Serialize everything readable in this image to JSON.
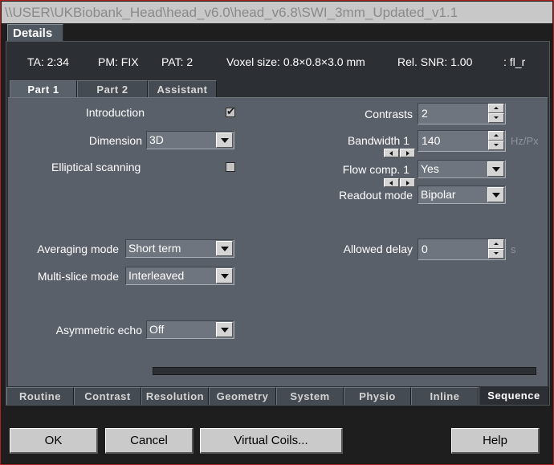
{
  "window": {
    "title": "\\\\USER\\UKBiobank_Head\\head_v6.0\\head_v6.8\\SWI_3mm_Updated_v1.1"
  },
  "details_tab": "Details",
  "info": {
    "ta": "TA: 2:34",
    "pm": "PM: FIX",
    "pat": "PAT: 2",
    "voxel": "Voxel size: 0.8×0.8×3.0 mm",
    "snr": "Rel. SNR: 1.00",
    "seq": ": fl_r"
  },
  "part_tabs": [
    {
      "label": "Part 1",
      "active": true
    },
    {
      "label": "Part 2",
      "active": false
    },
    {
      "label": "Assistant",
      "active": false
    }
  ],
  "left": {
    "introduction": {
      "label": "Introduction",
      "checked": true,
      "mark": "✔"
    },
    "dimension": {
      "label": "Dimension",
      "value": "3D"
    },
    "elliptical": {
      "label": "Elliptical scanning",
      "checked": false
    },
    "averaging": {
      "label": "Averaging mode",
      "value": "Short term"
    },
    "multislice": {
      "label": "Multi-slice mode",
      "value": "Interleaved"
    },
    "asymmetric": {
      "label": "Asymmetric echo",
      "value": "Off"
    }
  },
  "right": {
    "contrasts": {
      "label": "Contrasts",
      "value": "2"
    },
    "bandwidth": {
      "label": "Bandwidth 1",
      "value": "140",
      "unit": "Hz/Px"
    },
    "flowcomp": {
      "label": "Flow comp. 1",
      "value": "Yes"
    },
    "readout": {
      "label": "Readout mode",
      "value": "Bipolar"
    },
    "delay": {
      "label": "Allowed delay",
      "value": "0",
      "unit": "s"
    }
  },
  "bottom_tabs": [
    {
      "label": "Routine",
      "active": false
    },
    {
      "label": "Contrast",
      "active": false
    },
    {
      "label": "Resolution",
      "active": false
    },
    {
      "label": "Geometry",
      "active": false
    },
    {
      "label": "System",
      "active": false
    },
    {
      "label": "Physio",
      "active": false
    },
    {
      "label": "Inline",
      "active": false
    },
    {
      "label": "Sequence",
      "active": true
    }
  ],
  "buttons": {
    "ok": "OK",
    "cancel": "Cancel",
    "virtual_coils": "Virtual Coils...",
    "help": "Help"
  },
  "colors": {
    "accent_border": "#b02020",
    "panel": "#596069",
    "button": "#cacaca"
  }
}
